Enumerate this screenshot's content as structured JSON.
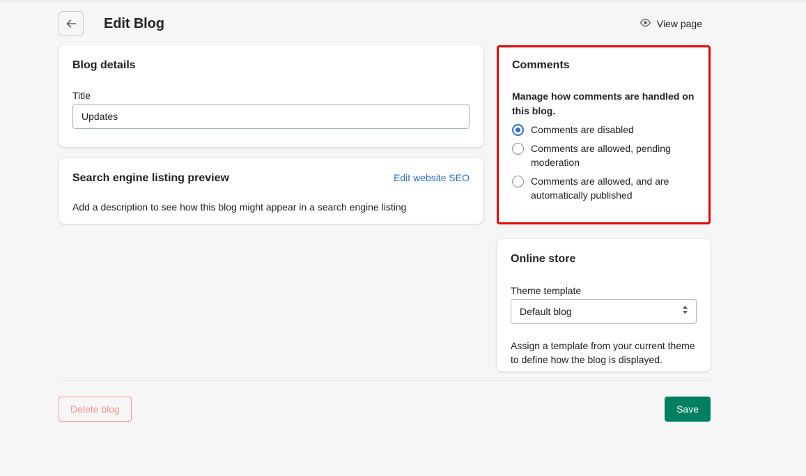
{
  "header": {
    "back_icon": "arrow-left-icon",
    "title": "Edit Blog",
    "view_page": {
      "icon": "eye-icon",
      "label": "View page"
    }
  },
  "blog_details": {
    "title": "Blog details",
    "title_field": {
      "label": "Title",
      "value": "Updates",
      "placeholder": ""
    }
  },
  "seo_preview": {
    "title": "Search engine listing preview",
    "edit_link": "Edit website SEO",
    "description": "Add a description to see how this blog might appear in a search engine listing"
  },
  "comments": {
    "title": "Comments",
    "legend": "Manage how comments are handled on this blog.",
    "highlight_color": "#ee0000",
    "options": [
      {
        "label": "Comments are disabled",
        "checked": true
      },
      {
        "label": "Comments are allowed, pending moderation",
        "checked": false
      },
      {
        "label": "Comments are allowed, and are automatically published",
        "checked": false
      }
    ]
  },
  "online_store": {
    "title": "Online store",
    "template_field": {
      "label": "Theme template",
      "value": "Default blog",
      "options": [
        "Default blog"
      ]
    },
    "help_text": "Assign a template from your current theme to define how the blog is displayed."
  },
  "footer": {
    "delete_label": "Delete blog",
    "save_label": "Save",
    "save_color": "#008060",
    "delete_color": "#fd938d"
  }
}
